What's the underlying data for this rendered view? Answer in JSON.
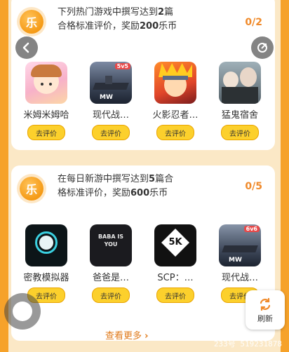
{
  "tasks": [
    {
      "coin_text": "乐",
      "line1_a": "下列热门游戏中撰写达到",
      "line1_b": "2",
      "line1_c": "篇",
      "line2_a": "合格标准评价，奖励",
      "line2_b": "200",
      "line2_c": "乐币",
      "progress": "0/2",
      "games": [
        {
          "name": "米姆米姆哈",
          "rate_label": "去评价"
        },
        {
          "name": "现代战…",
          "rate_label": "去评价",
          "badge": "5v5"
        },
        {
          "name": "火影忍者…",
          "rate_label": "去评价"
        },
        {
          "name": "猛鬼宿舍",
          "rate_label": "去评价"
        }
      ]
    },
    {
      "coin_text": "乐",
      "line1_a": "在每日新游中撰写达到",
      "line1_b": "5",
      "line1_c": "篇合",
      "line2_a": "格标准评价，奖励",
      "line2_b": "600",
      "line2_c": "乐币",
      "progress": "0/5",
      "games": [
        {
          "name": "密教模拟器",
          "rate_label": "去评价"
        },
        {
          "name": "爸爸是…",
          "rate_label": "去评价",
          "art_text": "BABA IS YOU"
        },
        {
          "name": "SCP：…",
          "rate_label": "去评价",
          "art_text": "5K"
        },
        {
          "name": "现代战…",
          "rate_label": "去评价",
          "badge": "6v6"
        }
      ]
    }
  ],
  "more_label": "查看更多",
  "refresh_label": "刷新",
  "watermark": "233号  519231878",
  "icons": [
    "back-icon",
    "share-icon",
    "refresh-icon",
    "chevron-right-icon"
  ],
  "colors": {
    "accent": "#f08a2a",
    "background": "#f6a22a",
    "button": "#fcd02c"
  }
}
